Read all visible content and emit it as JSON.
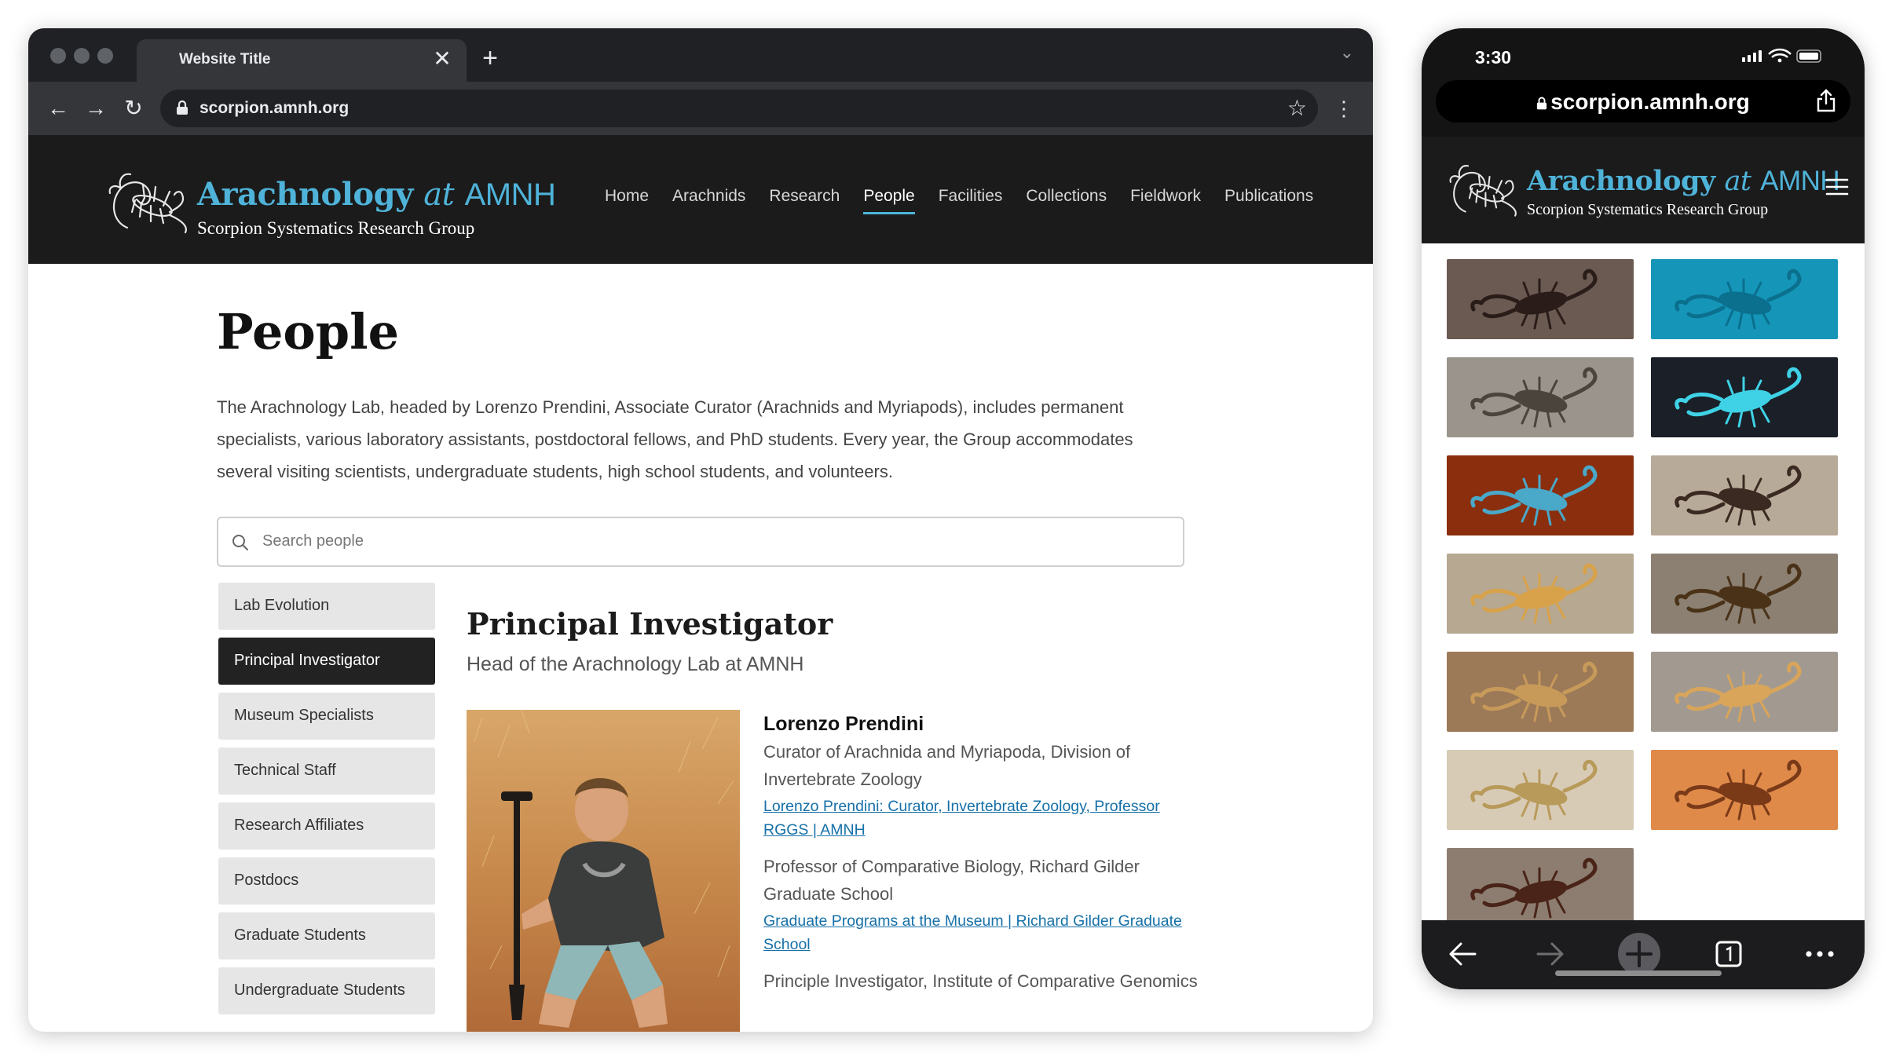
{
  "browser": {
    "tab_title": "Website Title",
    "close_glyph": "✕",
    "new_tab_glyph": "+",
    "tab_list_glyph": "⌄",
    "url": "scorpion.amnh.org",
    "back_glyph": "←",
    "forward_glyph": "→",
    "reload_glyph": "↻",
    "star_glyph": "☆",
    "menu_glyph": "⋮"
  },
  "site": {
    "logo_title_main": "Arachnology",
    "logo_title_at": "at",
    "logo_title_org": "AMNH",
    "logo_subtitle": "Scorpion Systematics Research Group",
    "nav": [
      {
        "label": "Home"
      },
      {
        "label": "Arachnids"
      },
      {
        "label": "Research"
      },
      {
        "label": "People",
        "active": true
      },
      {
        "label": "Facilities"
      },
      {
        "label": "Collections"
      },
      {
        "label": "Fieldwork"
      },
      {
        "label": "Publications"
      }
    ],
    "accent_color": "#4fb3d9",
    "header_bg": "#1b1b1b"
  },
  "page": {
    "title": "People",
    "intro": "The Arachnology Lab, headed by Lorenzo Prendini, Associate Curator (Arachnids and Myriapods), includes permanent specialists, various laboratory assistants, postdoctoral fellows, and PhD students. Every year, the Group accommodates several visiting scientists, undergraduate students, high school students, and volunteers.",
    "search_placeholder": "Search people",
    "sidebar": [
      {
        "label": "Lab Evolution"
      },
      {
        "label": "Principal Investigator",
        "active": true
      },
      {
        "label": "Museum Specialists"
      },
      {
        "label": "Technical Staff"
      },
      {
        "label": "Research Affiliates"
      },
      {
        "label": "Postdocs"
      },
      {
        "label": "Graduate Students"
      },
      {
        "label": "Undergraduate Students"
      }
    ],
    "section_title": "Principal Investigator",
    "section_subtitle": "Head of the Arachnology Lab at AMNH",
    "person": {
      "name": "Lorenzo Prendini",
      "positions": [
        {
          "text": "Curator of Arachnida and Myriapoda, Division of Invertebrate Zoology",
          "link": "Lorenzo Prendini: Curator, Invertebrate Zoology, Professor RGGS | AMNH"
        },
        {
          "text": "Professor of Comparative Biology, Richard Gilder Graduate School",
          "link": "Graduate Programs at the Museum | Richard Gilder Graduate School"
        },
        {
          "text": "Principle Investigator, Institute of Comparative Genomics"
        }
      ]
    }
  },
  "phone": {
    "time": "3:30",
    "url": "scorpion.amnh.org",
    "logo_title_main": "Arachnology",
    "logo_title_at": "at",
    "logo_title_org": "AMNH",
    "logo_subtitle": "Scorpion Systematics Research Group",
    "gallery": [
      {
        "icon": "scorpion-photo-dark-closeup",
        "bg": "#6b5a52",
        "body": "#2a1c18"
      },
      {
        "icon": "scorpion-photo-uv-blue",
        "bg": "#1596b8",
        "body": "#0b6f8e"
      },
      {
        "icon": "scorpion-photo-gray-sand",
        "bg": "#9a948c",
        "body": "#4a443d"
      },
      {
        "icon": "scorpion-photo-uv-cyan",
        "bg": "#1a1f28",
        "body": "#3fd2e6"
      },
      {
        "icon": "scorpion-photo-blue-on-red",
        "bg": "#8a2e0e",
        "body": "#4aa8c8"
      },
      {
        "icon": "scorpion-photo-dark-on-sand",
        "bg": "#b8aa98",
        "body": "#3b2a22"
      },
      {
        "icon": "scorpion-photo-yellow-on-sand",
        "bg": "#b7a892",
        "body": "#d8a24a"
      },
      {
        "icon": "scorpion-photo-brown-pincers",
        "bg": "#8c8072",
        "body": "#4a3218"
      },
      {
        "icon": "scorpion-photo-tan-rocks",
        "bg": "#9c7a58",
        "body": "#c89a5a"
      },
      {
        "icon": "scorpion-photo-tan-on-gray",
        "bg": "#a29a90",
        "body": "#d9a55a"
      },
      {
        "icon": "scorpion-photo-pale-on-sand",
        "bg": "#d8cbb6",
        "body": "#b89a5a"
      },
      {
        "icon": "scorpion-photo-orange-on-sand",
        "bg": "#e08a4a",
        "body": "#7a3a18"
      },
      {
        "icon": "scorpion-photo-partial",
        "bg": "#8d7d70",
        "body": "#4a2418"
      }
    ]
  }
}
